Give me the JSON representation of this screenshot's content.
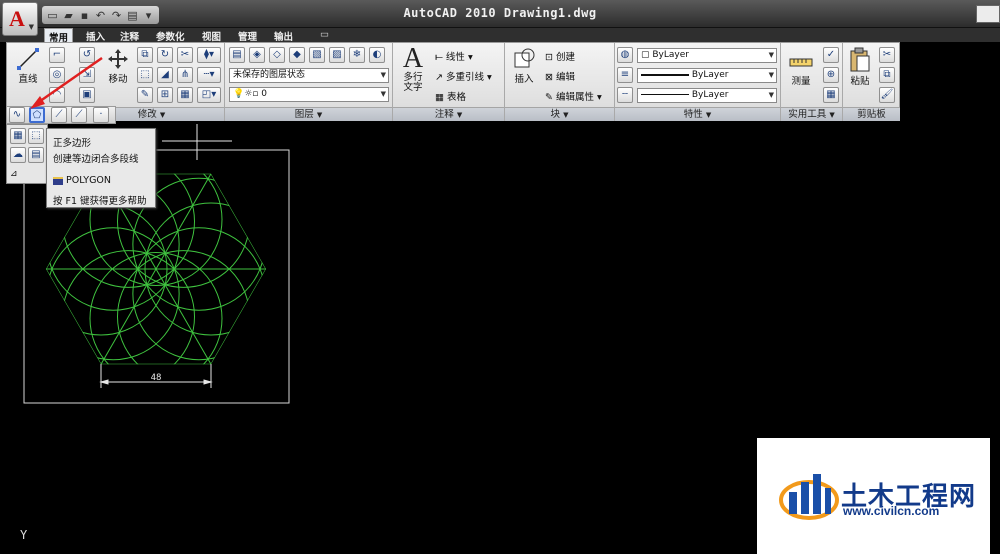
{
  "window": {
    "title": "AutoCAD 2010   Drawing1.dwg",
    "app_button_letter": "A"
  },
  "quick_access": {
    "icons": [
      "new-icon",
      "open-icon",
      "save-icon",
      "undo-icon",
      "redo-icon",
      "plot-icon",
      "customize-icon"
    ]
  },
  "ribbon_tabs": [
    {
      "label": "常用",
      "active": true
    },
    {
      "label": "插入"
    },
    {
      "label": "注释"
    },
    {
      "label": "参数化"
    },
    {
      "label": "视图"
    },
    {
      "label": "管理"
    },
    {
      "label": "输出"
    }
  ],
  "panels": {
    "draw": {
      "line_label": "直线"
    },
    "modify": {
      "title": "修改",
      "move_label": "移动"
    },
    "layers": {
      "title": "图层",
      "layer_state": "未保存的图层状态",
      "current_layer": "0"
    },
    "annotation": {
      "title": "注释",
      "mtext_label": "多行\n文字",
      "linear_label": "线性",
      "multileader_label": "多重引线",
      "table_label": "表格"
    },
    "block": {
      "title": "块",
      "insert_label": "插入",
      "create_label": "创建",
      "edit_label": "编辑",
      "edit_attr_label": "编辑属性"
    },
    "properties": {
      "title": "特性",
      "color": "ByLayer",
      "linetype": "ByLayer",
      "lineweight": "ByLayer"
    },
    "utilities": {
      "title": "实用工具",
      "measure_label": "测量"
    },
    "clipboard": {
      "title": "剪贴板",
      "paste_label": "粘贴"
    }
  },
  "tooltip": {
    "title": "正多边形",
    "description": "创建等边闭合多段线",
    "command": "POLYGON",
    "help": "按 F1 键获得更多帮助"
  },
  "drawing": {
    "dimension_text": "48",
    "line_color": "#3fc23f",
    "rect_color": "#d8d8d8"
  },
  "ucs": {
    "axis_label": "Y"
  },
  "watermark": {
    "name": "土木工程网",
    "url": "www.civilcn.com"
  }
}
